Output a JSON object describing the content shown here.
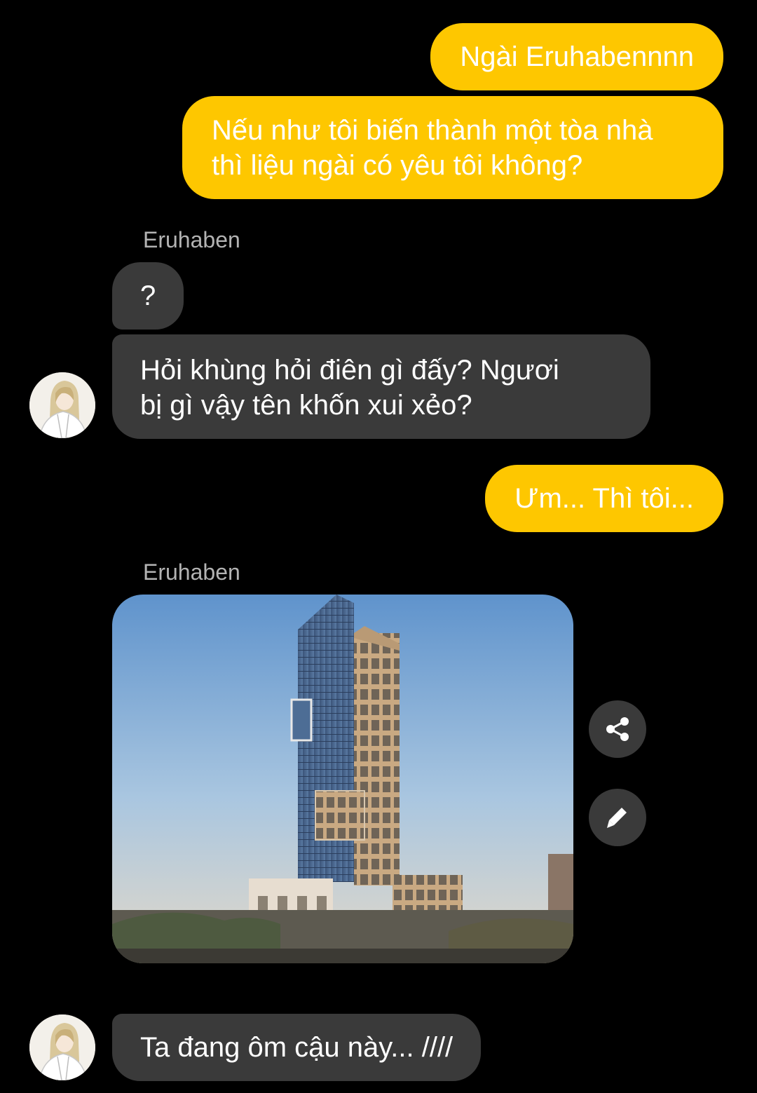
{
  "messages": [
    {
      "from": "me",
      "text": "Ngài Eruhabennnn"
    },
    {
      "from": "me",
      "text": "Nếu như tôi biến thành một tòa nhà\nthì liệu ngài có yêu tôi không?"
    },
    {
      "from": "them",
      "sender": "Eruhaben",
      "text": "?"
    },
    {
      "from": "them",
      "text": "Hỏi khùng hỏi điên gì đấy? Ngươi\nbị gì vậy tên khốn xui xẻo?"
    },
    {
      "from": "me",
      "text": "Ưm... Thì tôi..."
    },
    {
      "from": "them",
      "sender": "Eruhaben",
      "image": "tall-building-photo"
    },
    {
      "from": "them",
      "text": "Ta đang ôm cậu này... ////"
    }
  ],
  "actions": {
    "share_icon": "share-icon",
    "edit_icon": "pencil-icon"
  },
  "colors": {
    "background": "#000000",
    "my_bubble": "#fec700",
    "their_bubble": "#3a3a3a",
    "sender_name": "#b3b3b3"
  }
}
